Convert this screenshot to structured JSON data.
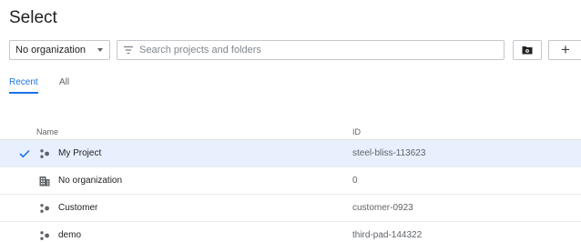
{
  "dialog": {
    "title": "Select"
  },
  "toolbar": {
    "org_select_value": "No organization",
    "search_placeholder": "Search projects and folders",
    "add_label": "+"
  },
  "tabs": [
    {
      "label": "Recent",
      "active": true
    },
    {
      "label": "All",
      "active": false
    }
  ],
  "table": {
    "columns": {
      "name": "Name",
      "id": "ID"
    },
    "rows": [
      {
        "name": "My Project",
        "id": "steel-bliss-113623",
        "type": "project",
        "selected": true
      },
      {
        "name": "No organization",
        "id": "0",
        "type": "organization",
        "selected": false
      },
      {
        "name": "Customer",
        "id": "customer-0923",
        "type": "project",
        "selected": false
      },
      {
        "name": "demo",
        "id": "third-pad-144322",
        "type": "project",
        "selected": false
      }
    ]
  },
  "colors": {
    "accent": "#1a73e8",
    "selected_row": "#e8f0fe"
  }
}
